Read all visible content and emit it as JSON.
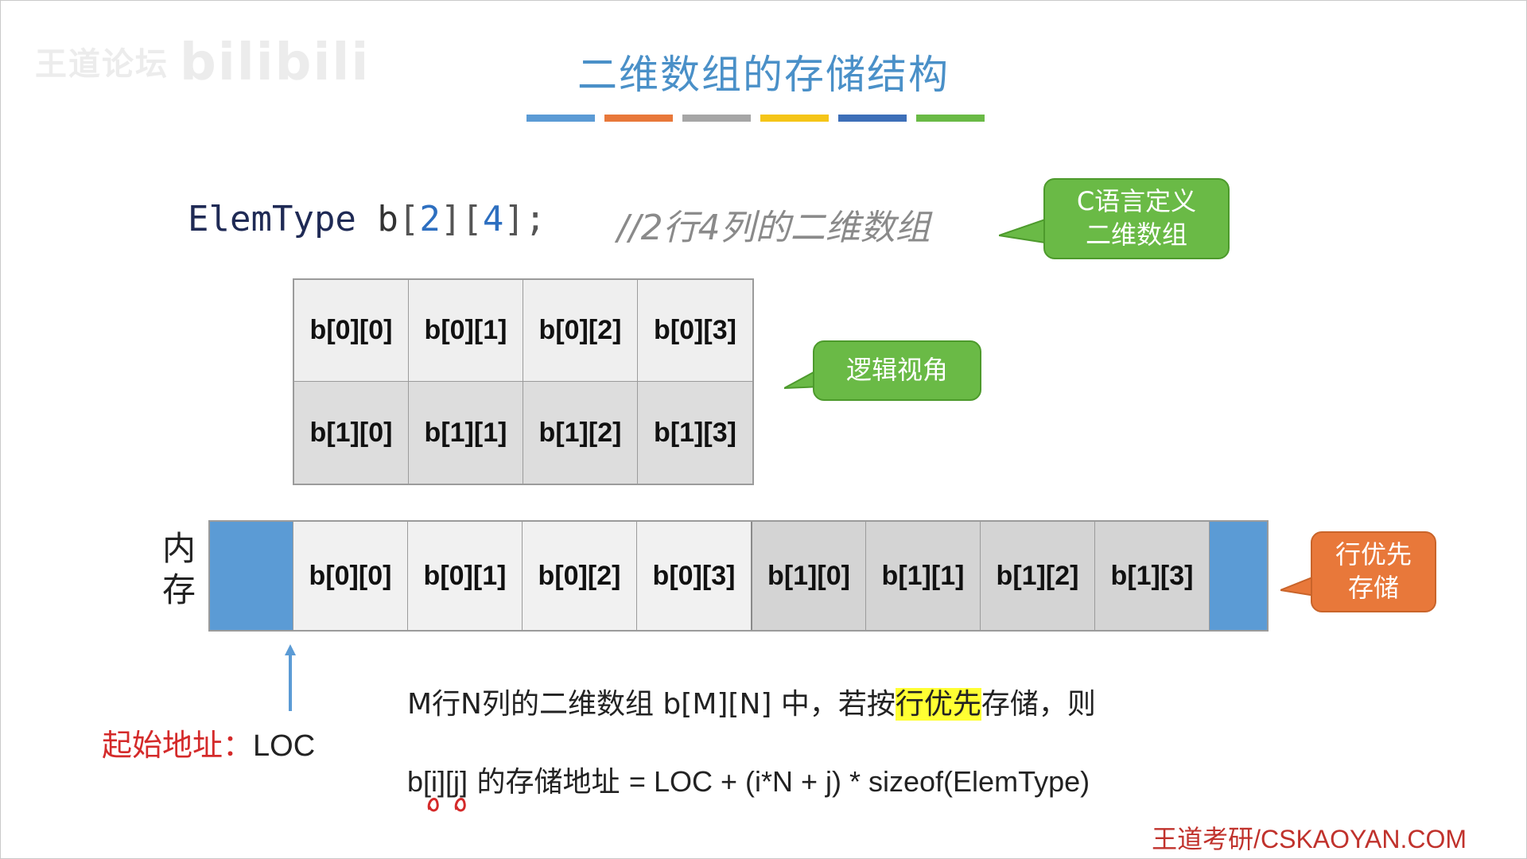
{
  "watermark": {
    "text": "王道论坛",
    "logo": "bilibili"
  },
  "title": "二维数组的存储结构",
  "color_bars": [
    "#5b9bd5",
    "#e8783a",
    "#a6a6a6",
    "#f5c518",
    "#3d6fb8",
    "#6aba46"
  ],
  "code": {
    "type": "ElemType",
    "var": "b",
    "dim1": "2",
    "dim2": "4",
    "comment": "//2行4列的二维数组"
  },
  "bubbles": {
    "c_def": {
      "line1": "C语言定义",
      "line2": "二维数组"
    },
    "logic": {
      "text": "逻辑视角"
    },
    "row_major": {
      "line1": "行优先",
      "line2": "存储"
    }
  },
  "grid": {
    "rows": [
      [
        "b[0][0]",
        "b[0][1]",
        "b[0][2]",
        "b[0][3]"
      ],
      [
        "b[1][0]",
        "b[1][1]",
        "b[1][2]",
        "b[1][3]"
      ]
    ]
  },
  "memory": {
    "label1": "内",
    "label2": "存",
    "cells": [
      "b[0][0]",
      "b[0][1]",
      "b[0][2]",
      "b[0][3]",
      "b[1][0]",
      "b[1][1]",
      "b[1][2]",
      "b[1][3]"
    ]
  },
  "start": {
    "label": "起始地址：",
    "loc": "LOC"
  },
  "description": {
    "pre": "M行N列的二维数组 b[M][N] 中，若按",
    "highlight": "行优先",
    "post": "存储，则"
  },
  "formula": {
    "lhs": "b[i][j]",
    "mid": " 的存储地址 ",
    "rhs": "= LOC + (i*N + j) * sizeof(ElemType)"
  },
  "footer": "王道考研/CSKAOYAN.COM"
}
